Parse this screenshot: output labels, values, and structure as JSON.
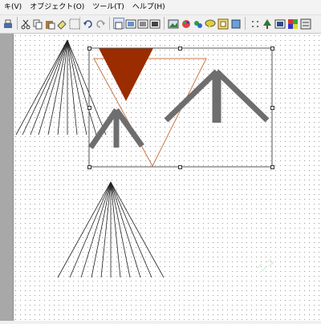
{
  "menu": {
    "items": [
      {
        "label": "キ(V)"
      },
      {
        "label": "オブジェクト(O)"
      },
      {
        "label": "ツール(T)"
      },
      {
        "label": "ヘルプ(H)"
      }
    ]
  },
  "toolbar": {
    "buttons": [
      "print",
      "cut",
      "copy",
      "paste",
      "eraser",
      "grid",
      "undo",
      "redo",
      "view-normal",
      "view-2",
      "view-3",
      "view-4",
      "image",
      "palette",
      "shape-a",
      "shape-b",
      "frame",
      "shape-c",
      "dots",
      "tree",
      "picture",
      "color",
      "settings"
    ]
  },
  "canvas": {
    "background": "#ffffff",
    "grid_color": "#9a9a9a",
    "watermark": "ニュ"
  },
  "colors": {
    "triangle_fill": "#9b2c00",
    "triangle_outline": "#c87a4a",
    "arrow_stroke": "#6e6e6e",
    "selection_border": "#555555"
  }
}
